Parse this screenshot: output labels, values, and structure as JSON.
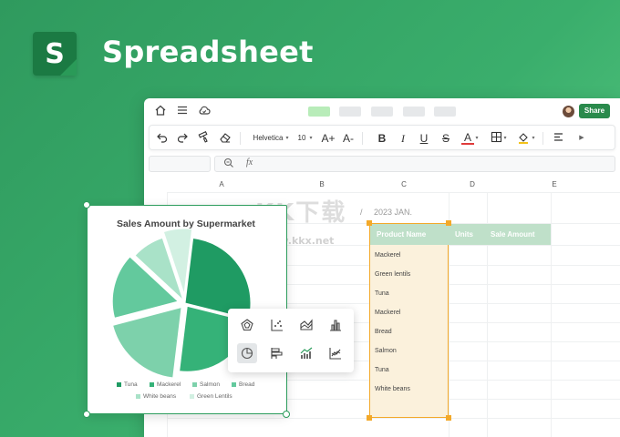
{
  "app": {
    "logo_letter": "S",
    "title": "Spreadsheet"
  },
  "colors": {
    "accent": "#2a8a4c",
    "header_fill": "#bfe0c9",
    "selection": "#f3a92a"
  },
  "titlebar": {
    "icons": [
      "home-icon",
      "menu-icon",
      "cloud-sync-icon"
    ],
    "share_label": "Share"
  },
  "toolbar": {
    "font_family": "Helvetica",
    "font_size": "10",
    "icons": [
      "undo-icon",
      "redo-icon",
      "format-painter-icon",
      "eraser-icon",
      "increase-font-icon",
      "decrease-font-icon",
      "bold-icon",
      "italic-icon",
      "underline-icon",
      "strikethrough-icon",
      "text-color-icon",
      "borders-icon",
      "fill-color-icon",
      "align-icon",
      "more-icon"
    ],
    "font_sizes": {
      "grow": "A+",
      "shrink": "A-"
    },
    "format_letters": {
      "bold": "B",
      "italic": "I",
      "underline": "U",
      "strike": "S",
      "color": "A"
    }
  },
  "formula_bar": {
    "zoom_icon": "zoom-icon",
    "fx_label": "fx"
  },
  "columns": [
    "A",
    "B",
    "C",
    "D",
    "E"
  ],
  "sheet": {
    "date_prefix": "/",
    "date": "2023 JAN.",
    "headers": [
      "Product Name",
      "Units",
      "Sale Amount"
    ],
    "products": [
      "Mackerel",
      "Green lentils",
      "Tuna",
      "Mackerel",
      "Bread",
      "Salmon",
      "Tuna",
      "White beans"
    ]
  },
  "watermark": {
    "text": "KK下载",
    "url": "www.kkx.net"
  },
  "chart_data": {
    "type": "pie",
    "title": "Sales Amount by Supermarket",
    "categories": [
      "Tuna",
      "Mackerel",
      "Salmon",
      "Bread",
      "White beans",
      "Green Lentils"
    ],
    "values": [
      27,
      23,
      19,
      16,
      8,
      7
    ],
    "colors": [
      "#1f9b63",
      "#35b278",
      "#7dd1ab",
      "#63c99d",
      "#a9e2c8",
      "#d2f0e2"
    ],
    "legend_position": "bottom"
  },
  "chart_types": [
    "radar-chart-icon",
    "scatter-chart-icon",
    "area-chart-icon",
    "column-chart-icon",
    "pie-chart-icon",
    "bar-chart-icon",
    "combo-chart-icon",
    "line-chart-icon"
  ]
}
